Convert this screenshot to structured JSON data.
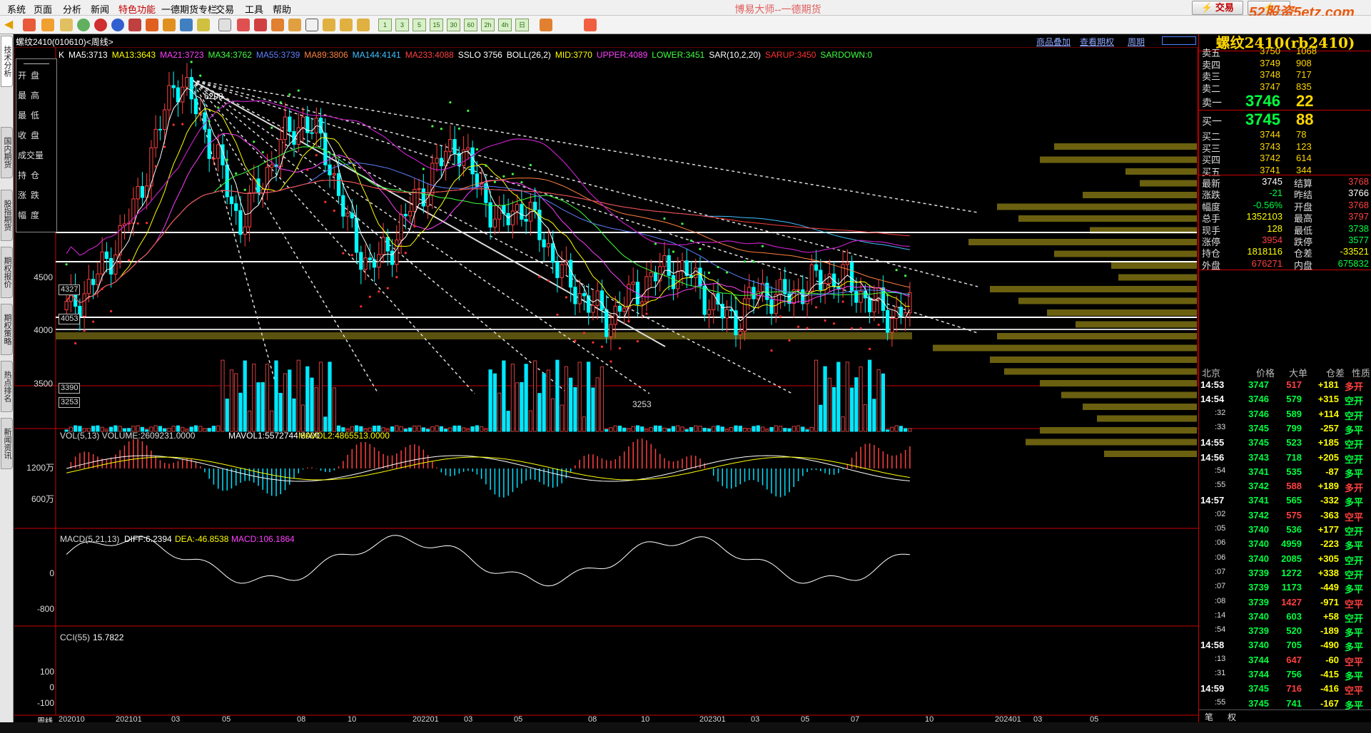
{
  "menu": [
    "系统",
    "页面",
    "分析",
    "新闻",
    "特色功能",
    "一德期货专栏",
    "交易",
    "工具",
    "帮助"
  ],
  "title": "博易大师--一德期货",
  "trade_button": "交易",
  "watermark": "52股资5etz.com",
  "toolbar_numbers": [
    "1",
    "3",
    "5",
    "15",
    "30",
    "60",
    "2h",
    "4h",
    "日"
  ],
  "left_tabs": [
    "技术分析",
    "国内期货",
    "股指期货",
    "期权报价",
    "期权策略",
    "热点排名",
    "新闻资讯"
  ],
  "chart_header": {
    "symbol": "螺纹2410(010610)<周线>",
    "links": [
      "商品叠加",
      "查看期权",
      "周期"
    ]
  },
  "ma_legend": [
    {
      "text": "K",
      "color": "#ffffff"
    },
    {
      "text": "MA5:3713",
      "color": "#ffffff"
    },
    {
      "text": "MA13:3643",
      "color": "#ffff00"
    },
    {
      "text": "MA21:3723",
      "color": "#ff40ff"
    },
    {
      "text": "MA34:3762",
      "color": "#40ff40"
    },
    {
      "text": "MA55:3739",
      "color": "#6080ff"
    },
    {
      "text": "MA89:3806",
      "color": "#ff8040"
    },
    {
      "text": "MA144:4141",
      "color": "#40c0ff"
    },
    {
      "text": "MA233:4088",
      "color": "#ff4040"
    },
    {
      "text": "SSLO 3756",
      "color": "#ffffff"
    },
    {
      "text": "BOLL(26,2)",
      "color": "#ffffff"
    },
    {
      "text": "MID:3770",
      "color": "#ffff00"
    },
    {
      "text": "UPPER:4089",
      "color": "#ff40ff"
    },
    {
      "text": "LOWER:3451",
      "color": "#40ff40"
    },
    {
      "text": "SAR(10,2,20)",
      "color": "#ffffff"
    },
    {
      "text": "SARUP:3450",
      "color": "#ff3030"
    },
    {
      "text": "SARDOWN:0",
      "color": "#40ff40"
    }
  ],
  "ohlc_labels": [
    "开盘",
    "最高",
    "最低",
    "收盘",
    "成交量",
    "持仓",
    "涨跌",
    "幅度"
  ],
  "price_axis": [
    "4500",
    "4000",
    "3500"
  ],
  "price_boxes": [
    "4327",
    "4053",
    "3390",
    "3253"
  ],
  "high_mark": "6208",
  "low_mark": "3253",
  "volume_panel": {
    "label": "VOL(5,13) VOLUME:2609231.0000",
    "mavol1": "MAVOL1:5572744.8000",
    "mavol2": "MAVOL2:4865513.0000",
    "axis": [
      "1200万",
      "600万"
    ]
  },
  "macd_panel": {
    "label": "MACD(5,21,13)",
    "diff": "DIFF:6.2394",
    "dea": "DEA:-46.8538",
    "macd": "MACD:106.1864",
    "axis": [
      "0",
      "-800"
    ]
  },
  "cci_panel": {
    "label": "CCI(55)",
    "value": "15.7822",
    "axis": [
      "100",
      "0",
      "-100"
    ]
  },
  "x_axis": [
    "周线",
    "202010",
    "202101",
    "03",
    "05",
    "08",
    "10",
    "202201",
    "03",
    "05",
    "08",
    "10",
    "202301",
    "03",
    "05",
    "07",
    "10",
    "202401",
    "03",
    "05"
  ],
  "right_panel": {
    "title": "螺纹2410(rb2410)",
    "asks": [
      {
        "label": "卖五",
        "price": "3750",
        "vol": "1068"
      },
      {
        "label": "卖四",
        "price": "3749",
        "vol": "908"
      },
      {
        "label": "卖三",
        "price": "3748",
        "vol": "717"
      },
      {
        "label": "卖二",
        "price": "3747",
        "vol": "835"
      }
    ],
    "ask1": {
      "label": "卖一",
      "price": "3746",
      "vol": "22"
    },
    "bid1": {
      "label": "买一",
      "price": "3745",
      "vol": "88"
    },
    "bids": [
      {
        "label": "买二",
        "price": "3744",
        "vol": "78"
      },
      {
        "label": "买三",
        "price": "3743",
        "vol": "123"
      },
      {
        "label": "买四",
        "price": "3742",
        "vol": "614"
      },
      {
        "label": "买五",
        "price": "3741",
        "vol": "344"
      }
    ],
    "stats": [
      {
        "k1": "最新",
        "v1": "3745",
        "c1": "#ffffff",
        "k2": "结算",
        "v2": "3768",
        "c2": "#ff4040"
      },
      {
        "k1": "涨跌",
        "v1": "-21",
        "c1": "#00ff40",
        "k2": "昨结",
        "v2": "3766",
        "c2": "#ffffff"
      },
      {
        "k1": "幅度",
        "v1": "-0.56%",
        "c1": "#00ff40",
        "k2": "开盘",
        "v2": "3768",
        "c2": "#ff4040"
      },
      {
        "k1": "总手",
        "v1": "1352103",
        "c1": "#ffff00",
        "k2": "最高",
        "v2": "3797",
        "c2": "#ff4040"
      },
      {
        "k1": "现手",
        "v1": "128",
        "c1": "#ffff00",
        "k2": "最低",
        "v2": "3738",
        "c2": "#00ff40"
      },
      {
        "k1": "涨停",
        "v1": "3954",
        "c1": "#ff4040",
        "k2": "跌停",
        "v2": "3577",
        "c2": "#00ff40"
      },
      {
        "k1": "持仓",
        "v1": "1818116",
        "c1": "#ffff00",
        "k2": "仓差",
        "v2": "-33521",
        "c2": "#ffff00"
      },
      {
        "k1": "外盘",
        "v1": "676271",
        "c1": "#ff4040",
        "k2": "内盘",
        "v2": "675832",
        "c2": "#00ff40"
      }
    ],
    "tick_header": {
      "time": "北京",
      "price": "价格",
      "vol": "大单",
      "diff": "仓差",
      "nature": "性质"
    },
    "ticks": [
      {
        "t": "14:53",
        "p": "3747",
        "v": "517",
        "d": "+181",
        "n": "多开",
        "vc": "#ff4040",
        "nc": "#ff4040"
      },
      {
        "t": "14:54",
        "p": "3746",
        "v": "579",
        "d": "+315",
        "n": "空开",
        "vc": "#00ff40",
        "nc": "#00ff40"
      },
      {
        "t": ":32",
        "p": "3746",
        "v": "589",
        "d": "+114",
        "n": "空开",
        "vc": "#00ff40",
        "nc": "#00ff40",
        "sub": true
      },
      {
        "t": ":33",
        "p": "3745",
        "v": "799",
        "d": "-257",
        "n": "多平",
        "vc": "#00ff40",
        "nc": "#00ff40",
        "sub": true
      },
      {
        "t": "14:55",
        "p": "3745",
        "v": "523",
        "d": "+185",
        "n": "空开",
        "vc": "#00ff40",
        "nc": "#00ff40"
      },
      {
        "t": "14:56",
        "p": "3743",
        "v": "718",
        "d": "+205",
        "n": "空开",
        "vc": "#00ff40",
        "nc": "#00ff40"
      },
      {
        "t": ":54",
        "p": "3741",
        "v": "535",
        "d": "-87",
        "n": "多平",
        "vc": "#00ff40",
        "nc": "#00ff40",
        "sub": true
      },
      {
        "t": ":55",
        "p": "3742",
        "v": "588",
        "d": "+189",
        "n": "多开",
        "vc": "#ff4040",
        "nc": "#ff4040",
        "sub": true
      },
      {
        "t": "14:57",
        "p": "3741",
        "v": "565",
        "d": "-332",
        "n": "多平",
        "vc": "#00ff40",
        "nc": "#00ff40"
      },
      {
        "t": ":02",
        "p": "3742",
        "v": "575",
        "d": "-363",
        "n": "空平",
        "vc": "#ff4040",
        "nc": "#ff4040",
        "sub": true
      },
      {
        "t": ":05",
        "p": "3740",
        "v": "536",
        "d": "+177",
        "n": "空开",
        "vc": "#00ff40",
        "nc": "#00ff40",
        "sub": true
      },
      {
        "t": ":06",
        "p": "3740",
        "v": "4959",
        "d": "-223",
        "n": "多平",
        "vc": "#00ff40",
        "nc": "#00ff40",
        "sub": true
      },
      {
        "t": ":06",
        "p": "3740",
        "v": "2085",
        "d": "+305",
        "n": "空开",
        "vc": "#00ff40",
        "nc": "#00ff40",
        "sub": true
      },
      {
        "t": ":07",
        "p": "3739",
        "v": "1272",
        "d": "+338",
        "n": "空开",
        "vc": "#00ff40",
        "nc": "#00ff40",
        "sub": true
      },
      {
        "t": ":07",
        "p": "3739",
        "v": "1173",
        "d": "-449",
        "n": "多平",
        "vc": "#00ff40",
        "nc": "#00ff40",
        "sub": true
      },
      {
        "t": ":08",
        "p": "3739",
        "v": "1427",
        "d": "-971",
        "n": "空平",
        "vc": "#ff4040",
        "nc": "#ff4040",
        "sub": true
      },
      {
        "t": ":14",
        "p": "3740",
        "v": "603",
        "d": "+58",
        "n": "空开",
        "vc": "#00ff40",
        "nc": "#00ff40",
        "sub": true
      },
      {
        "t": ":54",
        "p": "3739",
        "v": "520",
        "d": "-189",
        "n": "多平",
        "vc": "#00ff40",
        "nc": "#00ff40",
        "sub": true
      },
      {
        "t": "14:58",
        "p": "3740",
        "v": "705",
        "d": "-490",
        "n": "多平",
        "vc": "#00ff40",
        "nc": "#00ff40"
      },
      {
        "t": ":13",
        "p": "3744",
        "v": "647",
        "d": "-60",
        "n": "空平",
        "vc": "#ff4040",
        "nc": "#ff4040",
        "sub": true
      },
      {
        "t": ":31",
        "p": "3744",
        "v": "756",
        "d": "-415",
        "n": "多平",
        "vc": "#00ff40",
        "nc": "#00ff40",
        "sub": true
      },
      {
        "t": "14:59",
        "p": "3745",
        "v": "716",
        "d": "-416",
        "n": "空平",
        "vc": "#ff4040",
        "nc": "#ff4040"
      },
      {
        "t": ":55",
        "p": "3745",
        "v": "741",
        "d": "-167",
        "n": "多平",
        "vc": "#00ff40",
        "nc": "#00ff40",
        "sub": true
      }
    ],
    "footer_tabs": [
      "笔",
      "权"
    ]
  },
  "chart_data": {
    "type": "candlestick",
    "note_levels": {
      "highest": 6208,
      "lowest": 3253
    },
    "ylim_price": [
      3100,
      6400
    ],
    "x_labels": [
      "202010",
      "202101",
      "03",
      "05",
      "08",
      "10",
      "202201",
      "03",
      "05",
      "08",
      "10",
      "202301",
      "03",
      "05",
      "07",
      "10",
      "202401",
      "03",
      "05"
    ],
    "close_series_approx": [
      3700,
      3900,
      4200,
      4600,
      5200,
      5900,
      5600,
      5100,
      4500,
      4900,
      5300,
      5500,
      5200,
      4500,
      4100,
      4300,
      4700,
      5000,
      5300,
      4900,
      4500,
      4700,
      4400,
      4000,
      3800,
      3600,
      3800,
      4000,
      4100,
      4000,
      3700,
      3600,
      3900,
      3800,
      3900,
      4000,
      4000,
      3800,
      3650,
      3700
    ],
    "volume_axis_max": 1500
  }
}
